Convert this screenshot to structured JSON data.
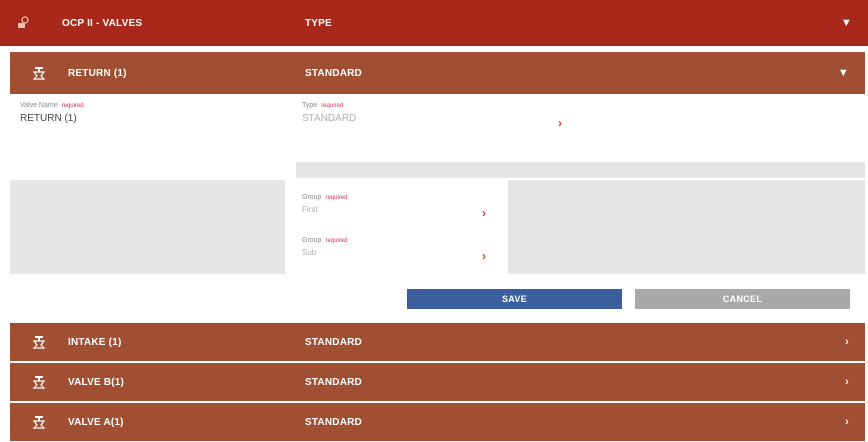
{
  "header": {
    "title": "OCP II - VALVES",
    "type_col": "TYPE",
    "icon": "valve-icon",
    "chevron": "▼"
  },
  "expanded_row": {
    "name": "RETURN (1)",
    "type": "STANDARD",
    "icon": "valve-icon",
    "chevron": "▼"
  },
  "form": {
    "valve_name_label": "Valve Name",
    "valve_name_required": "required",
    "valve_name_value": "RETURN (1)",
    "type_label": "Type",
    "type_required": "required",
    "type_value": "STANDARD",
    "section_bar_text": "",
    "group1_label": "Group",
    "group1_required": "required",
    "group1_value": "First",
    "group2_label": "Group",
    "group2_required": "required",
    "group2_value": "Sub",
    "arrow": "›",
    "save_label": "SAVE",
    "cancel_label": "CANCEL"
  },
  "rows": [
    {
      "name": "INTAKE (1)",
      "type": "STANDARD",
      "chevron": "›",
      "icon": "valve-icon"
    },
    {
      "name": "VALVE B(1)",
      "type": "STANDARD",
      "chevron": "›",
      "icon": "valve-icon"
    },
    {
      "name": "VALVE A(1)",
      "type": "STANDARD",
      "chevron": "›",
      "icon": "valve-icon"
    }
  ],
  "colors": {
    "header_bg": "#a8291a",
    "row_bg": "#a14f33",
    "save_bg": "#3a5f9c",
    "cancel_bg": "#a9a9a9",
    "accent_arrow": "#d23b2b"
  }
}
